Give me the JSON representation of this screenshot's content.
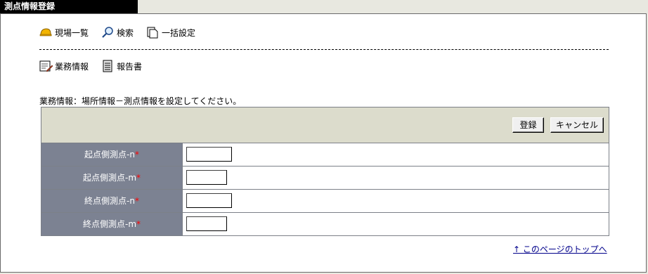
{
  "window": {
    "title": "測点情報登録"
  },
  "nav": {
    "site_list": "現場一覧",
    "search": "検索",
    "bulk_settings": "一括設定",
    "business_info": "業務情報",
    "report": "報告書"
  },
  "instruction": "業務情報：場所情報－測点情報を設定してください。",
  "buttons": {
    "register": "登録",
    "cancel": "キャンセル"
  },
  "fields": [
    {
      "label": "起点側測点-n",
      "value": ""
    },
    {
      "label": "起点側測点-m",
      "value": ""
    },
    {
      "label": "終点側測点-n",
      "value": ""
    },
    {
      "label": "終点側測点-m",
      "value": ""
    }
  ],
  "required_mark": "*",
  "back_to_top": "↑ このページのトップへ",
  "colors": {
    "label_bg": "#7c8292",
    "header_bg": "#dcdccc",
    "required": "#ff0000",
    "link": "#00008b"
  }
}
